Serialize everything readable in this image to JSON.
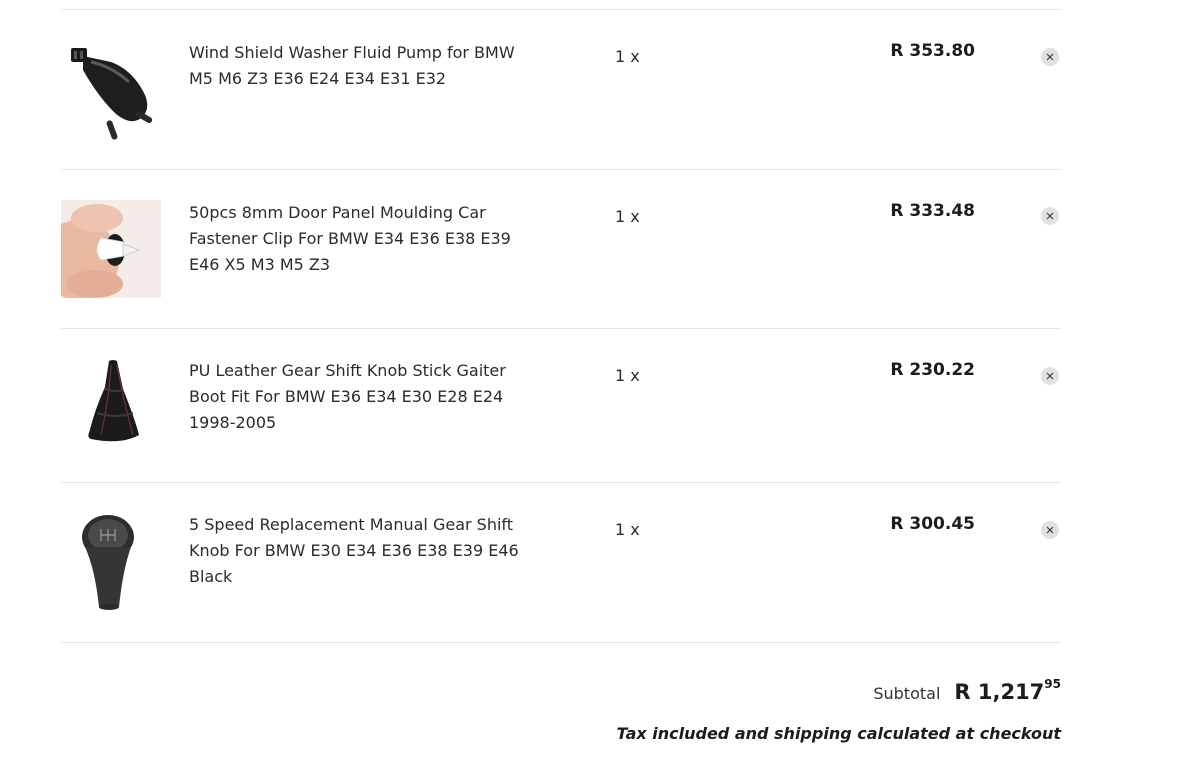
{
  "cart": {
    "items": [
      {
        "title": "Wind Shield Washer Fluid Pump for BMW M5 M6 Z3 E36 E24 E34 E31 E32",
        "quantity": "1 x",
        "price": "R 353.80",
        "image_icon": "washer-pump-product-image"
      },
      {
        "title": "50pcs 8mm Door Panel Moulding Car Fastener Clip For BMW E34 E36 E38 E39 E46 X5 M3 M5 Z3",
        "quantity": "1 x",
        "price": "R 333.48",
        "image_icon": "fastener-clip-product-image"
      },
      {
        "title": "PU Leather Gear Shift Knob Stick Gaiter Boot Fit For BMW E36 E34 E30 E28 E24 1998-2005",
        "quantity": "1 x",
        "price": "R 230.22",
        "image_icon": "gaiter-boot-product-image"
      },
      {
        "title": "5 Speed Replacement Manual Gear Shift Knob For BMW E30 E34 E36 E38 E39 E46 Black",
        "quantity": "1 x",
        "price": "R 300.45",
        "image_icon": "gear-knob-product-image"
      }
    ],
    "remove_icon": "close-icon"
  },
  "summary": {
    "subtotal_label": "Subtotal",
    "subtotal_main": "R 1,217",
    "subtotal_cents": "95",
    "tax_note": "Tax included and shipping calculated at checkout"
  },
  "colors": {
    "divider": "#e6e6e6",
    "remove_bg": "#e0e0e0",
    "text": "#2b2b2b"
  }
}
